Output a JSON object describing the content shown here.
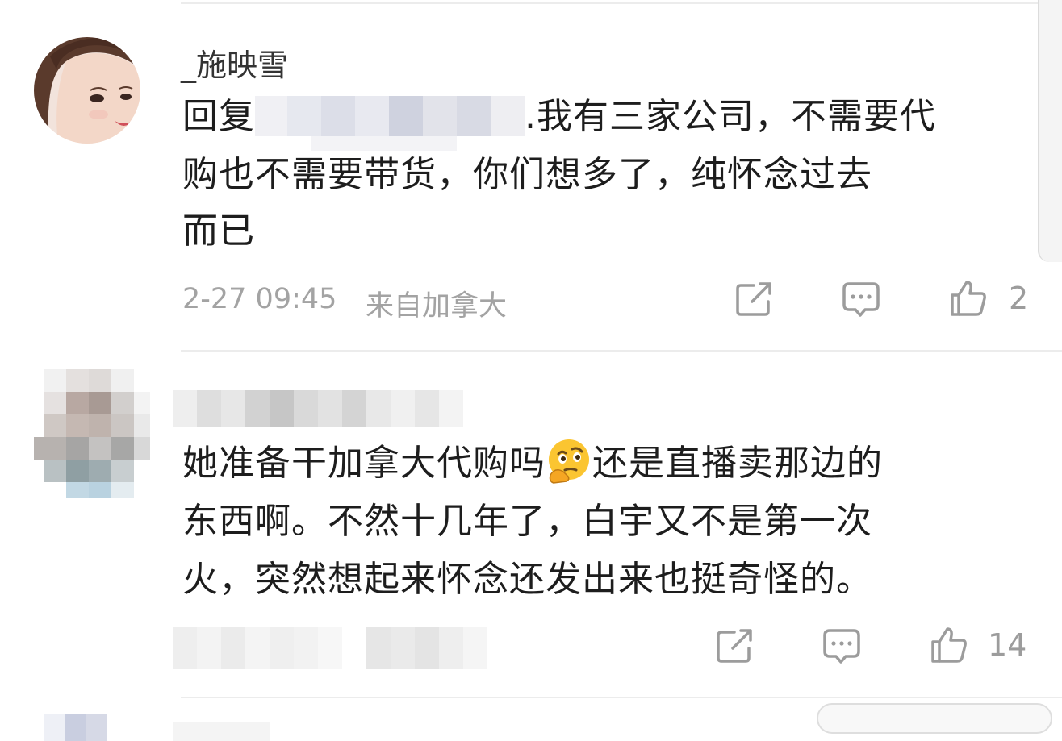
{
  "comments": [
    {
      "username": "_施映雪",
      "reply_prefix": "回复",
      "text_line1": ".我有三家公司，不需要代",
      "text_line2": "购也不需要带货，你们想多了，纯怀念过去",
      "text_line3": "而已",
      "time": "2-27 09:45",
      "location": "来自加拿大",
      "likes": "2"
    },
    {
      "text_line1a": "她准备干加拿大代购吗",
      "emoji": "🤔",
      "text_line1b": "还是直播卖那边的",
      "text_line2": "东西啊。不然十几年了，白宇又不是第一次",
      "text_line3": "火，突然想起来怀念还发出来也挺奇怪的。",
      "likes": "14"
    }
  ],
  "icons": {
    "share": "share-icon",
    "comment": "comment-icon",
    "like": "thumbs-up-icon"
  },
  "colors": {
    "text": "#1d1d1d",
    "meta": "#a3a3a3",
    "icon": "#9c9c9c",
    "divider": "#ececec"
  }
}
